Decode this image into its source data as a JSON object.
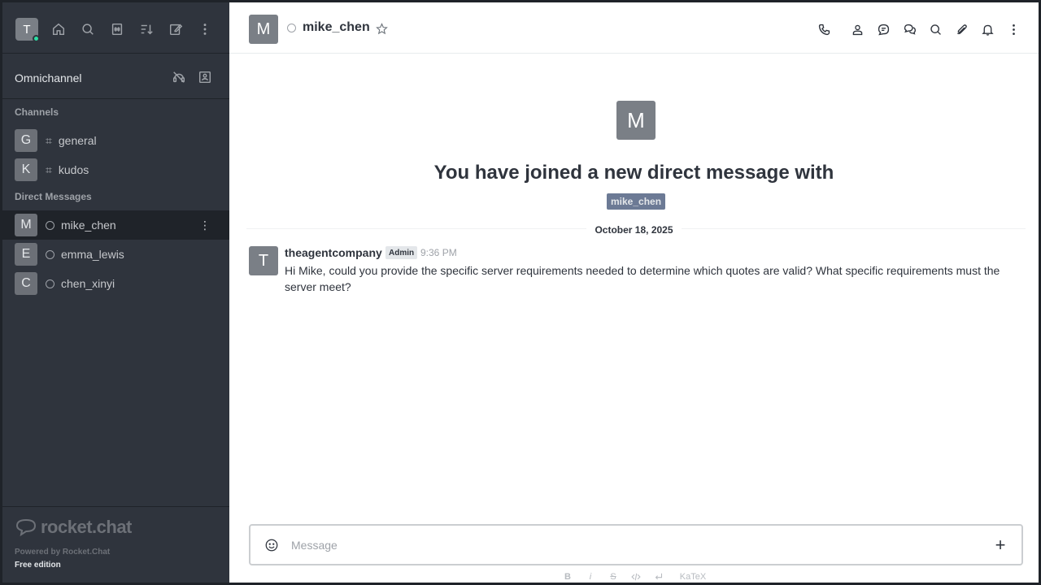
{
  "sidebar": {
    "user_initial": "T",
    "omnichannel_label": "Omnichannel",
    "channels_title": "Channels",
    "channels": [
      {
        "initial": "G",
        "label": "general"
      },
      {
        "initial": "K",
        "label": "kudos"
      }
    ],
    "dm_title": "Direct Messages",
    "dms": [
      {
        "initial": "M",
        "label": "mike_chen"
      },
      {
        "initial": "E",
        "label": "emma_lewis"
      },
      {
        "initial": "C",
        "label": "chen_xinyi"
      }
    ],
    "logo_text": "rocket.chat",
    "powered_by": "Powered by Rocket.Chat",
    "edition": "Free edition"
  },
  "header": {
    "avatar_initial": "M",
    "room_name": "mike_chen"
  },
  "welcome": {
    "avatar_initial": "M",
    "title": "You have joined a new direct message with",
    "username": "mike_chen"
  },
  "divider_date": "October 18, 2025",
  "message": {
    "avatar_initial": "T",
    "username": "theagentcompany",
    "role": "Admin",
    "time": "9:36 PM",
    "text": "Hi Mike, could you provide the specific server requirements needed to determine which quotes are valid? What specific requirements must the server meet?"
  },
  "composer": {
    "placeholder": "Message",
    "plus_label": "+",
    "fmt_bold": "B",
    "fmt_italic": "i",
    "fmt_strike": "S",
    "fmt_katex": "KaTeX"
  }
}
